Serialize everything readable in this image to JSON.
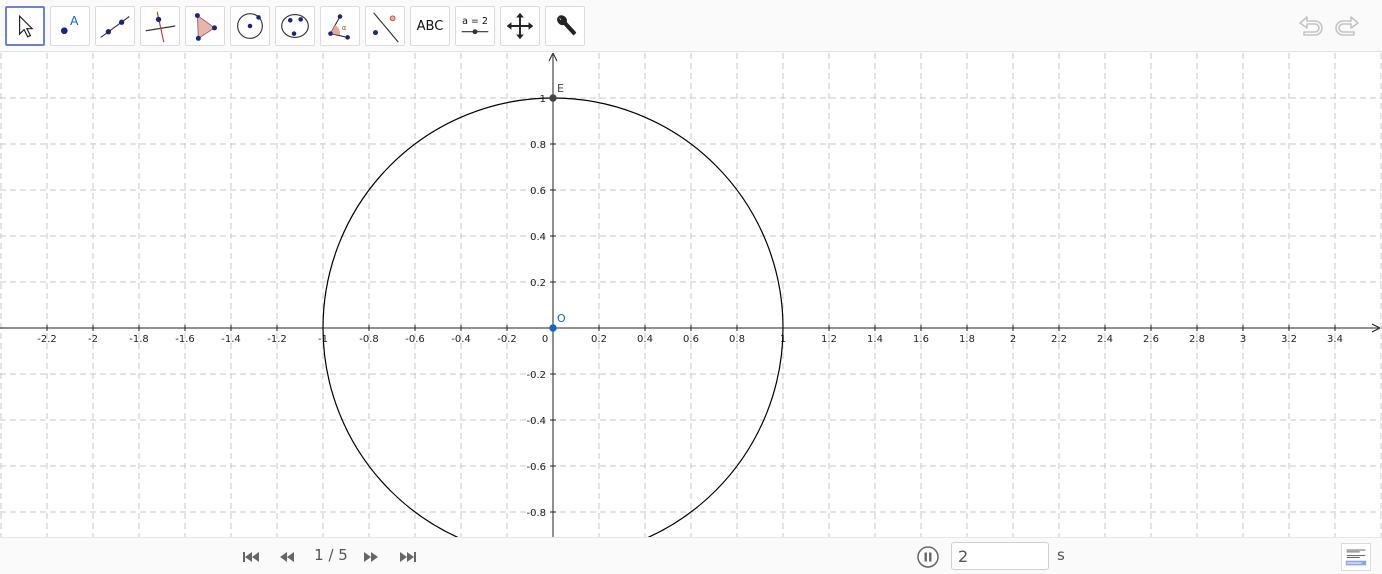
{
  "toolbar": {
    "tools": [
      {
        "id": "move",
        "name": "move-tool-button",
        "icon": "arrow-cursor-icon",
        "active": true
      },
      {
        "id": "point",
        "name": "point-tool-button",
        "icon": "point-icon",
        "label": "A"
      },
      {
        "id": "line",
        "name": "line-tool-button",
        "icon": "line-through-points-icon"
      },
      {
        "id": "perpendicular",
        "name": "perpendicular-line-tool-button",
        "icon": "perpendicular-line-icon"
      },
      {
        "id": "polygon",
        "name": "polygon-tool-button",
        "icon": "polygon-icon"
      },
      {
        "id": "circle",
        "name": "circle-tool-button",
        "icon": "circle-center-point-icon"
      },
      {
        "id": "conic",
        "name": "conic-tool-button",
        "icon": "ellipse-icon"
      },
      {
        "id": "angle",
        "name": "angle-tool-button",
        "icon": "angle-icon"
      },
      {
        "id": "reflect",
        "name": "reflect-tool-button",
        "icon": "reflect-about-line-icon"
      },
      {
        "id": "text",
        "name": "text-tool-button",
        "icon": "text-icon",
        "label": "ABC"
      },
      {
        "id": "slider",
        "name": "slider-tool-button",
        "icon": "slider-icon",
        "label": "a = 2"
      },
      {
        "id": "move-view",
        "name": "move-graphics-view-button",
        "icon": "move-arrows-icon"
      },
      {
        "id": "settings",
        "name": "settings-button",
        "icon": "wrench-icon"
      }
    ],
    "undo_icon": "undo-icon",
    "redo_icon": "redo-icon"
  },
  "graphics": {
    "x_ticks": [
      "-2.2",
      "-2",
      "-1.8",
      "-1.6",
      "-1.4",
      "-1.2",
      "-1",
      "-0.8",
      "-0.6",
      "-0.4",
      "-0.2",
      "0",
      "0.2",
      "0.4",
      "0.6",
      "0.8",
      "1",
      "1.2",
      "1.4",
      "1.6",
      "1.8",
      "2",
      "2.2",
      "2.4",
      "2.6",
      "2.8",
      "3",
      "3.2",
      "3.4"
    ],
    "y_ticks": [
      "1",
      "0.8",
      "0.6",
      "0.4",
      "0.2",
      "-0.2",
      "-0.4",
      "-0.6",
      "-0.8"
    ],
    "points": [
      {
        "label": "E",
        "x": 0,
        "y": 1,
        "color": "#444444"
      },
      {
        "label": "O",
        "x": 0,
        "y": 0,
        "color": "#1565c0"
      }
    ],
    "circle": {
      "center_x": 0,
      "center_y": 0,
      "radius": 1,
      "color": "#000000"
    },
    "x_range": [
      -2.4,
      3.6
    ],
    "y_range": [
      -0.9,
      1.2
    ],
    "grid": true
  },
  "bottombar": {
    "slide_counter": "1 / 5",
    "speed_value": "2",
    "speed_unit": "s",
    "nav_icons": [
      "first-slide-icon",
      "previous-slide-icon",
      "next-slide-icon",
      "last-slide-icon"
    ],
    "play_icon": "pause-icon",
    "algebra_icon": "algebra-view-icon"
  }
}
